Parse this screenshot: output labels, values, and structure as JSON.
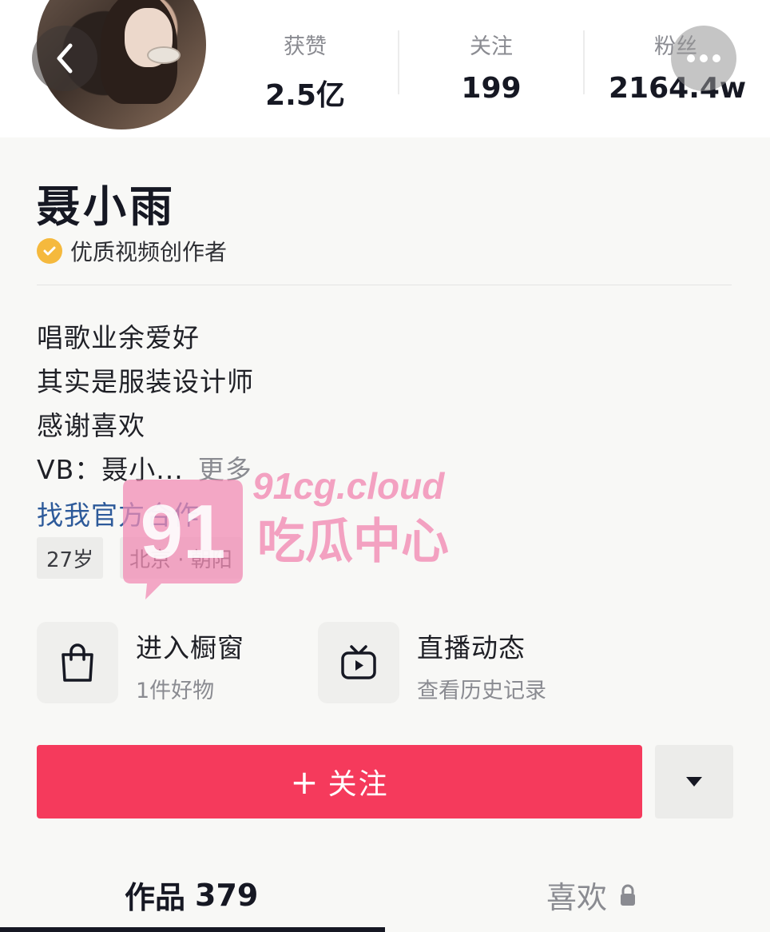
{
  "stats": [
    {
      "label": "获赞",
      "value": "2.5亿"
    },
    {
      "label": "关注",
      "value": "199"
    },
    {
      "label": "粉丝",
      "value": "2164.4w"
    }
  ],
  "profile": {
    "name": "聂小雨",
    "certification": "优质视频创作者"
  },
  "bio": {
    "lines": [
      "唱歌业余爱好",
      "其实是服装设计师",
      "感谢喜欢"
    ],
    "vb_line": "VB：聂小...",
    "more_label": "更多",
    "link_label": "找我官方合作"
  },
  "tags": [
    "27岁",
    "北京 · 朝阳"
  ],
  "cards": [
    {
      "title": "进入橱窗",
      "subtitle": "1件好物"
    },
    {
      "title": "直播动态",
      "subtitle": "查看历史记录"
    }
  ],
  "actions": {
    "follow_plus": "+",
    "follow_label": "关注"
  },
  "tabs": {
    "works_label": "作品",
    "works_count": "379",
    "likes_label": "喜欢"
  },
  "watermark": {
    "badge": "91",
    "domain": "91cg.cloud",
    "slogan": "吃瓜中心"
  },
  "colors": {
    "follow_button": "#f53a5c",
    "link": "#2d5a9a",
    "badge": "#f5b93d",
    "watermark": "#f28cb4"
  }
}
